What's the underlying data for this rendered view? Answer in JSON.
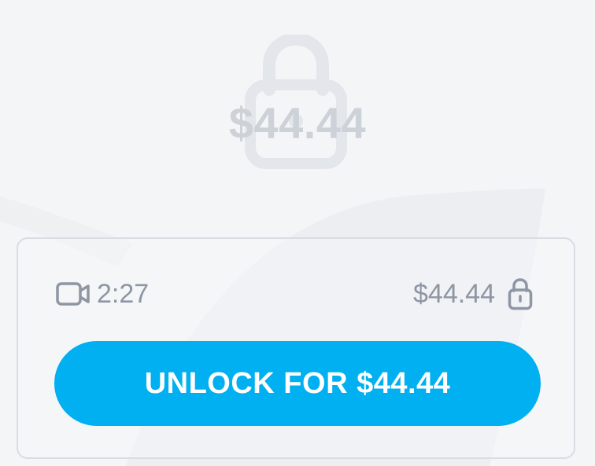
{
  "preview": {
    "price": "$44.44",
    "lock_icon": "lock-icon"
  },
  "media": {
    "duration": "2:27",
    "type_icon": "video-camera-icon",
    "price": "$44.44",
    "lock_icon": "lock-icon"
  },
  "unlock": {
    "label": "UNLOCK FOR $44.44"
  },
  "colors": {
    "background": "#f4f5f7",
    "accent": "#00b0f0",
    "muted_text": "#8e96a4",
    "faded_overlay": "#cdd1d8",
    "card_border": "#d9dde3"
  }
}
